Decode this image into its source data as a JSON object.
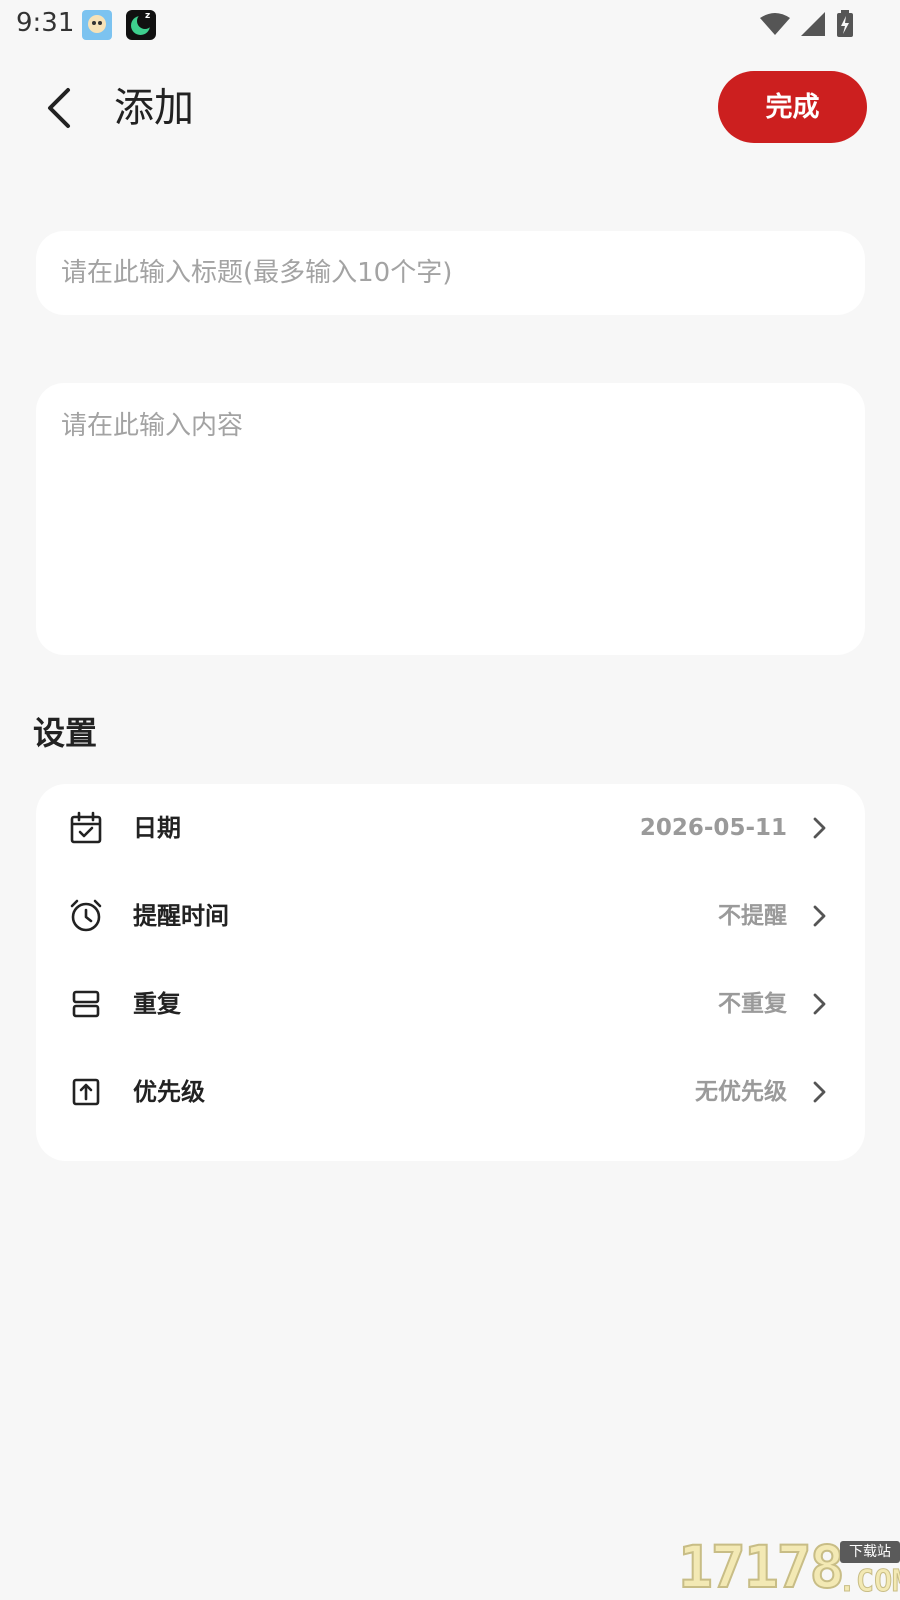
{
  "status_bar": {
    "time": "9:31",
    "icons": [
      "app-avatar-icon",
      "moon-sleep-app-icon",
      "wifi-icon",
      "cellular-signal-icon",
      "battery-charging-icon"
    ]
  },
  "header": {
    "title": "添加",
    "done_label": "完成",
    "accent_color": "#cc1f1f"
  },
  "form": {
    "title_placeholder": "请在此输入标题(最多输入10个字)",
    "title_value": "",
    "content_placeholder": "请在此输入内容",
    "content_value": ""
  },
  "settings": {
    "heading": "设置",
    "rows": [
      {
        "icon": "calendar-check-icon",
        "label": "日期",
        "value": "2026-05-11"
      },
      {
        "icon": "alarm-clock-icon",
        "label": "提醒时间",
        "value": "不提醒"
      },
      {
        "icon": "repeat-stack-icon",
        "label": "重复",
        "value": "不重复"
      },
      {
        "icon": "priority-upload-icon",
        "label": "优先级",
        "value": "无优先级"
      }
    ]
  },
  "watermark": {
    "digits": "17178",
    "tag": "下载站",
    "suffix": ".COM"
  }
}
